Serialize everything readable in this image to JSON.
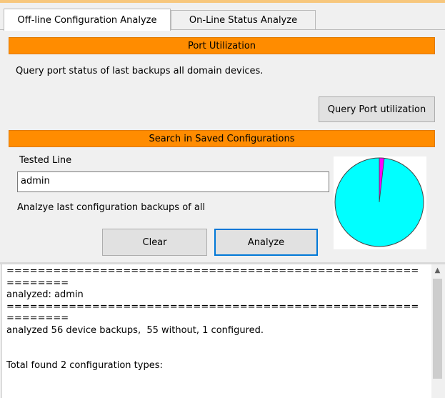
{
  "tabs": [
    {
      "label": "Off-line Configuration Analyze",
      "active": true
    },
    {
      "label": "On-Line Status Analyze",
      "active": false
    }
  ],
  "port_utilization": {
    "header": "Port Utilization",
    "description": "Query port status of last backups all domain devices.",
    "query_button": "Query Port utilization"
  },
  "search": {
    "header": "Search in Saved Configurations",
    "tested_line_label": "Tested Line",
    "tested_line_value": "admin",
    "analyze_description": "Analzye last configuration backups of all",
    "clear_button": "Clear",
    "analyze_button": "Analyze"
  },
  "pie": {
    "without": 55,
    "configured": 1,
    "colors": {
      "without": "#00ffff",
      "configured": "#ff00ff"
    }
  },
  "output": {
    "lines": [
      "=====================================================",
      "========",
      "analyzed: admin",
      "=====================================================",
      "========",
      "analyzed 56 device backups,  55 without, 1 configured.",
      "",
      "",
      "Total found 2 configuration types:"
    ]
  },
  "icons": {
    "scroll_up": "chevron-up-icon"
  },
  "colors": {
    "section_header": "#ff8c00",
    "focus_border": "#0078d7"
  }
}
